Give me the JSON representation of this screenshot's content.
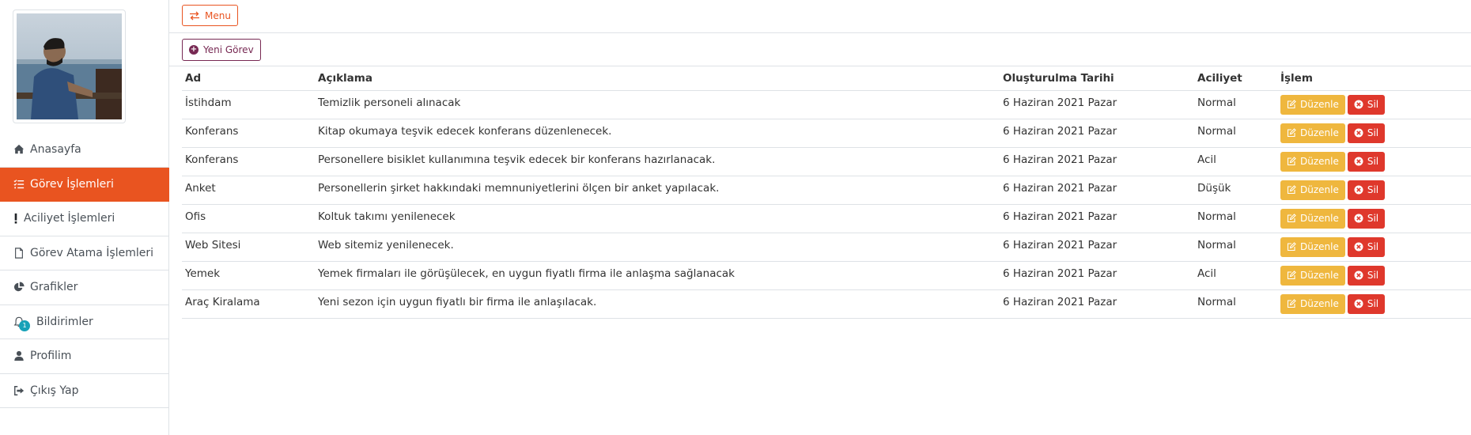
{
  "sidebar": {
    "items": [
      {
        "label": "Anasayfa",
        "icon": "home-icon"
      },
      {
        "label": "Görev İşlemleri",
        "icon": "task-list-icon",
        "active": true
      },
      {
        "label": "Aciliyet İşlemleri",
        "icon": "exclamation-icon"
      },
      {
        "label": "Görev Atama İşlemleri",
        "icon": "file-icon"
      },
      {
        "label": "Grafikler",
        "icon": "pie-chart-icon"
      },
      {
        "label": "Bildirimler",
        "icon": "bell-icon",
        "badge": "1"
      },
      {
        "label": "Profilim",
        "icon": "user-icon"
      },
      {
        "label": "Çıkış Yap",
        "icon": "sign-out-icon"
      }
    ]
  },
  "topbar": {
    "menu_label": "Menu"
  },
  "toolbar": {
    "new_task_label": "Yeni Görev"
  },
  "table": {
    "headers": [
      "Ad",
      "Açıklama",
      "Oluşturulma Tarihi",
      "Aciliyet",
      "İşlem"
    ],
    "edit_label": "Düzenle",
    "delete_label": "Sil",
    "rows": [
      [
        "İstihdam",
        "Temizlik personeli alınacak",
        "6 Haziran 2021 Pazar",
        "Normal"
      ],
      [
        "Konferans",
        "Kitap okumaya teşvik edecek konferans düzenlenecek.",
        "6 Haziran 2021 Pazar",
        "Normal"
      ],
      [
        "Konferans",
        "Personellere bisiklet kullanımına teşvik edecek bir konferans hazırlanacak.",
        "6 Haziran 2021 Pazar",
        "Acil"
      ],
      [
        "Anket",
        "Personellerin şirket hakkındaki memnuniyetlerini ölçen bir anket yapılacak.",
        "6 Haziran 2021 Pazar",
        "Düşük"
      ],
      [
        "Ofis",
        "Koltuk takımı yenilenecek",
        "6 Haziran 2021 Pazar",
        "Normal"
      ],
      [
        "Web Sitesi",
        "Web sitemiz yenilenecek.",
        "6 Haziran 2021 Pazar",
        "Normal"
      ],
      [
        "Yemek",
        "Yemek firmaları ile görüşülecek, en uygun fiyatlı firma ile anlaşma sağlanacak",
        "6 Haziran 2021 Pazar",
        "Acil"
      ],
      [
        "Araç Kiralama",
        "Yeni sezon için uygun fiyatlı bir firma ile anlaşılacak.",
        "6 Haziran 2021 Pazar",
        "Normal"
      ]
    ]
  },
  "colors": {
    "primary": "#e95420",
    "secondary": "#772953",
    "warning": "#efb73e",
    "danger": "#df382c",
    "info": "#17a2b8"
  }
}
